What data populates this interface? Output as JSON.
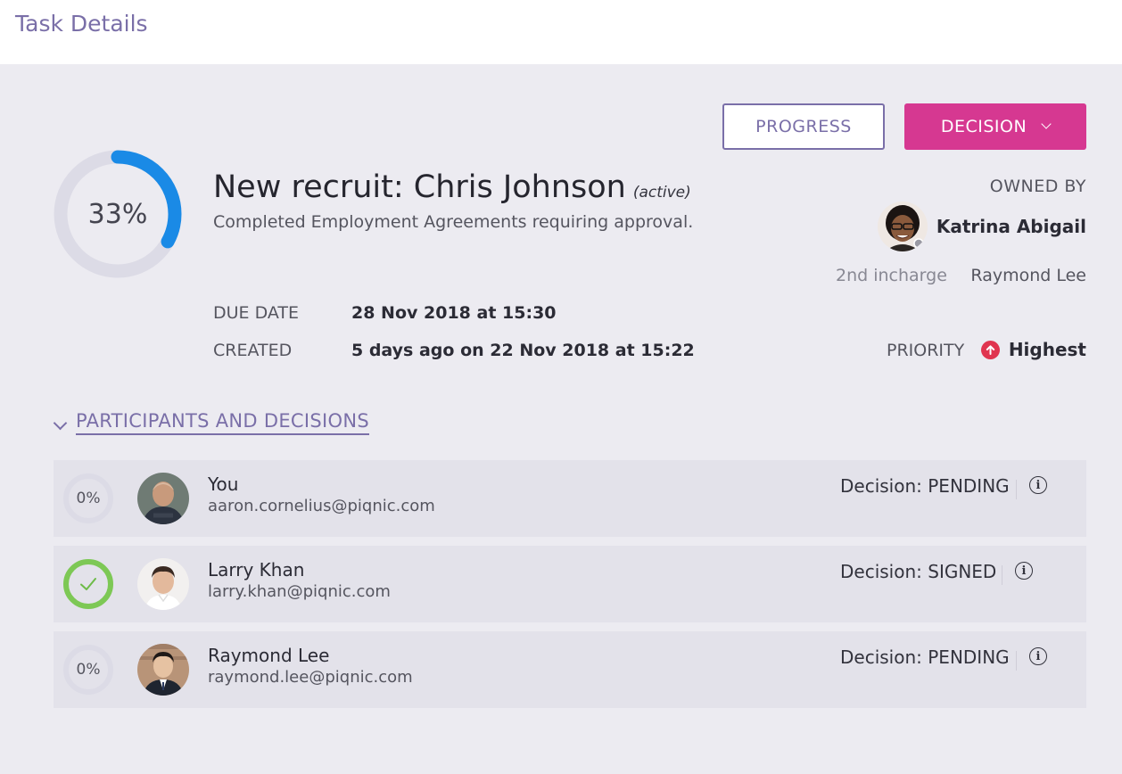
{
  "header": {
    "title": "Task Details"
  },
  "actions": {
    "progress_label": "PROGRESS",
    "decision_label": "DECISION"
  },
  "task": {
    "progress_text": "33%",
    "progress_fraction": 0.33,
    "title": "New recruit: Chris Johnson",
    "status": "(active)",
    "description": "Completed Employment Agreements requiring approval.",
    "due_label": "DUE DATE",
    "due_value": "28 Nov 2018 at 15:30",
    "created_label": "CREATED",
    "created_value": "5 days ago on 22 Nov 2018 at 15:22"
  },
  "owner": {
    "owned_by_label": "OWNED BY",
    "name": "Katrina Abigail",
    "incharge_label": "2nd incharge",
    "incharge_name": "Raymond Lee",
    "priority_label": "PRIORITY",
    "priority_value": "Highest",
    "priority_icon": "arrow-up-circle-icon"
  },
  "participants_section": {
    "title": "PARTICIPANTS AND DECISIONS",
    "rows": [
      {
        "name": "You",
        "email": "aaron.cornelius@piqnic.com",
        "progress_text": "0%",
        "complete": false,
        "decision": "Decision: PENDING"
      },
      {
        "name": "Larry Khan",
        "email": "larry.khan@piqnic.com",
        "progress_text": "",
        "complete": true,
        "decision": "Decision: SIGNED"
      },
      {
        "name": "Raymond Lee",
        "email": "raymond.lee@piqnic.com",
        "progress_text": "0%",
        "complete": false,
        "decision": "Decision: PENDING"
      }
    ]
  },
  "colors": {
    "accent": "#7a6fa8",
    "decision_button": "#d63891",
    "progress_ring": "#1a8ae6",
    "ring_track": "#dcdbe6",
    "complete_green": "#7dc855",
    "priority_red": "#e0344f"
  }
}
